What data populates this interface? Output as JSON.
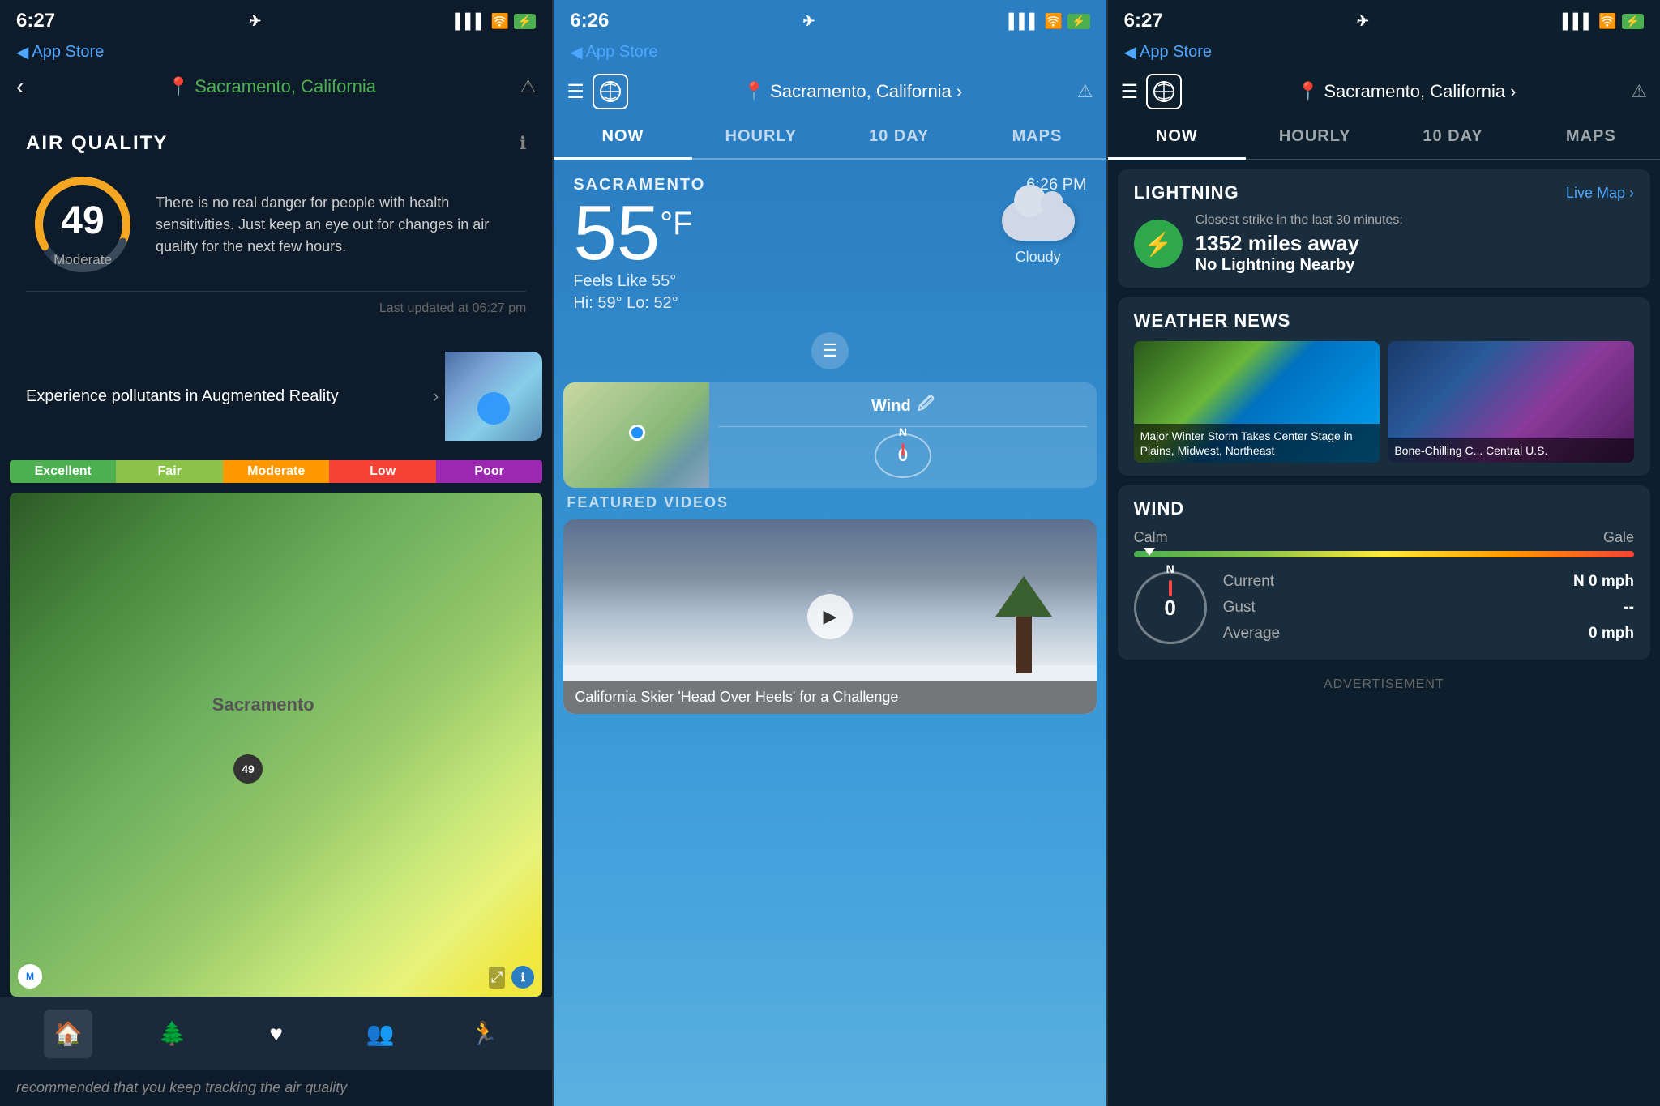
{
  "leftPanel": {
    "statusBar": {
      "time": "6:27",
      "arrow": "◀",
      "appStore": "App Store",
      "signal": "▌▌▌▌",
      "wifi": "WiFi",
      "battery": "⚡"
    },
    "nav": {
      "back": "‹",
      "location": "Sacramento, California",
      "warning": "⚠"
    },
    "airQuality": {
      "title": "AIR QUALITY",
      "aqi": "49",
      "aqiLabel": "Moderate",
      "description": "There is no real danger for people with health sensitivities. Just keep an eye out for changes in air quality for the next few hours.",
      "lastUpdated": "Last updated at 06:27 pm"
    },
    "arBanner": {
      "text": "Experience pollutants in Augmented Reality",
      "arrow": "›"
    },
    "aqiScale": [
      {
        "label": "Excellent",
        "color": "#4caf50"
      },
      {
        "label": "Fair",
        "color": "#8bc34a"
      },
      {
        "label": "Moderate",
        "color": "#ff9800"
      },
      {
        "label": "Low",
        "color": "#f44336"
      },
      {
        "label": "Poor",
        "color": "#9c27b0"
      }
    ],
    "mapLabel": "Sacramento",
    "mapMarkerValue": "49",
    "bottomScroll": "recommended that you keep tracking the air quality",
    "navItems": [
      "🏠",
      "🌲",
      "❤",
      "👥",
      "🏃"
    ]
  },
  "middlePanel": {
    "statusBar": {
      "time": "6:26",
      "arrow": "◀",
      "appStore": "App Store"
    },
    "nav": {
      "location": "Sacramento, California",
      "arrow": "›",
      "warning": "⚠"
    },
    "tabs": [
      "NOW",
      "HOURLY",
      "10 DAY",
      "MAPS"
    ],
    "activeTab": "NOW",
    "weather": {
      "city": "SACRAMENTO",
      "time": "6:26 PM",
      "temperature": "55",
      "unit": "°F",
      "feelsLike": "Feels Like 55°",
      "hiLo": "Hi: 59°  Lo: 52°",
      "condition": "Cloudy"
    },
    "wind": {
      "title": "Wind",
      "editIcon": "✏",
      "compassValue": "0",
      "compassN": "N"
    },
    "featuredVideos": {
      "title": "FEATURED VIDEOS",
      "caption": "California Skier 'Head Over Heels' for a Challenge"
    }
  },
  "rightPanel": {
    "statusBar": {
      "time": "6:27",
      "arrow": "◀",
      "appStore": "App Store"
    },
    "nav": {
      "location": "Sacramento, California",
      "arrow": "›",
      "warning": "⚠"
    },
    "tabs": [
      "NOW",
      "HOURLY",
      "10 DAY",
      "MAPS"
    ],
    "activeTab": "NOW",
    "lightning": {
      "title": "LIGHTNING",
      "liveMapLink": "Live Map ›",
      "subtitle": "Closest strike in the last 30 minutes:",
      "distance": "1352 miles away",
      "status": "No Lightning Nearby"
    },
    "weatherNews": {
      "title": "WEATHER NEWS",
      "article1": "Major Winter Storm Takes Center Stage in Plains, Midwest, Northeast",
      "article2": "Bone-Chilling C... Central U.S."
    },
    "wind": {
      "title": "WIND",
      "scaleLabels": {
        "calm": "Calm",
        "gale": "Gale"
      },
      "current": "N 0 mph",
      "gust": "--",
      "average": "0 mph",
      "currentLabel": "Current",
      "gustLabel": "Gust",
      "averageLabel": "Average",
      "compassValue": "0",
      "compassN": "N"
    },
    "advertisement": "ADVERTISEMENT"
  }
}
